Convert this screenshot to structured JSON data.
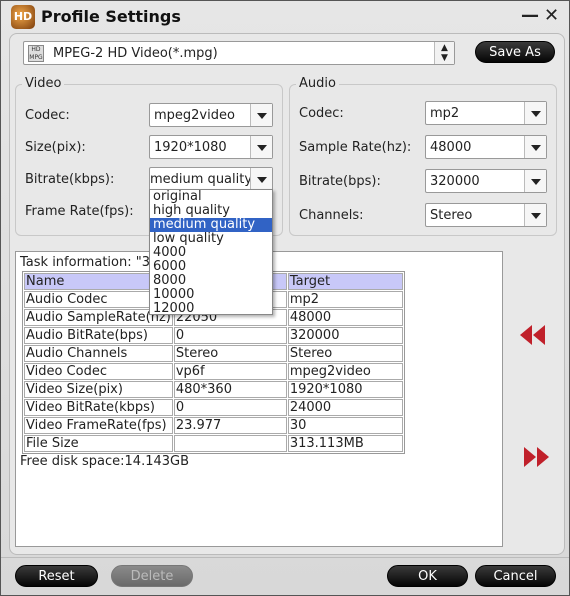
{
  "window": {
    "title": "Profile Settings",
    "minimize_label": "—",
    "close_label": "✕"
  },
  "profile": {
    "selected": "MPEG-2 HD Video(*.mpg)",
    "icon": "mpg-file-icon",
    "icon_text": "HD MPG",
    "spinner": "▲▼",
    "save_as_label": "Save As"
  },
  "video": {
    "group_label": "Video",
    "codec": {
      "label": "Codec:",
      "value": "mpeg2video"
    },
    "size": {
      "label": "Size(pix):",
      "value": "1920*1080"
    },
    "bitrate": {
      "label": "Bitrate(kbps):",
      "value": "medium quality",
      "options": [
        "original",
        "high quality",
        "medium quality",
        "low quality",
        "4000",
        "6000",
        "8000",
        "10000",
        "12000"
      ],
      "selected_index": 2
    },
    "framerate": {
      "label": "Frame Rate(fps):"
    }
  },
  "audio": {
    "group_label": "Audio",
    "codec": {
      "label": "Codec:",
      "value": "mp2"
    },
    "sample_rate": {
      "label": "Sample Rate(hz):",
      "value": "48000"
    },
    "bitrate": {
      "label": "Bitrate(bps):",
      "value": "320000"
    },
    "channels": {
      "label": "Channels:",
      "value": "Stereo"
    }
  },
  "task": {
    "title": "Task information: \"3",
    "columns": [
      "Name",
      "",
      "Target"
    ],
    "rows": [
      [
        "Audio Codec",
        "",
        "mp2"
      ],
      [
        "Audio SampleRate(hz)",
        "22050",
        "48000"
      ],
      [
        "Audio BitRate(bps)",
        "0",
        "320000"
      ],
      [
        "Audio Channels",
        "Stereo",
        "Stereo"
      ],
      [
        "Video Codec",
        "vp6f",
        "mpeg2video"
      ],
      [
        "Video Size(pix)",
        "480*360",
        "1920*1080"
      ],
      [
        "Video BitRate(kbps)",
        "0",
        "24000"
      ],
      [
        "Video FrameRate(fps)",
        "23.977",
        "30"
      ],
      [
        "File Size",
        "",
        "313.113MB"
      ]
    ],
    "free_disk": "Free disk space:14.143GB"
  },
  "side": {
    "collapse_icon": "double-left-arrow-icon",
    "expand_icon": "double-right-arrow-icon"
  },
  "footer": {
    "reset_label": "Reset",
    "delete_label": "Delete",
    "ok_label": "OK",
    "cancel_label": "Cancel"
  }
}
